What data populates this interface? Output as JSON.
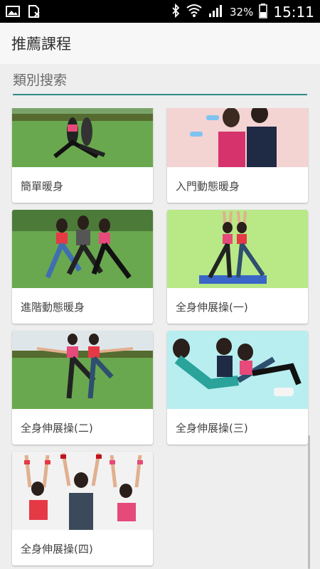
{
  "status_bar": {
    "battery": "32%",
    "time": "15:11"
  },
  "header": {
    "title": "推薦課程"
  },
  "search": {
    "label": "類別搜索"
  },
  "courses": [
    {
      "label": "簡單暖身"
    },
    {
      "label": "入門動態暖身"
    },
    {
      "label": "進階動態暖身"
    },
    {
      "label": "全身伸展操(一)"
    },
    {
      "label": "全身伸展操(二)"
    },
    {
      "label": "全身伸展操(三)"
    },
    {
      "label": "全身伸展操(四)"
    }
  ],
  "colors": {
    "accent": "#2e8b86",
    "status_bar": "#000000",
    "background": "#eeeeee"
  }
}
